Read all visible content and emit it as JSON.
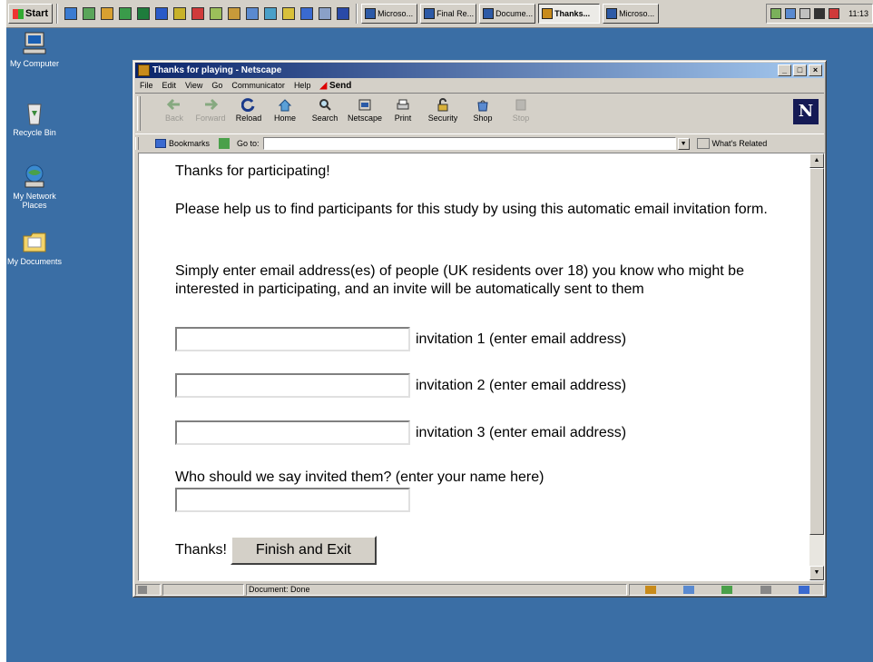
{
  "taskbar": {
    "start_label": "Start",
    "quick_launch": [
      "ie-icon",
      "desktop-icon",
      "app-icon",
      "app-icon",
      "app-icon",
      "app-icon",
      "app-icon",
      "app-icon",
      "app-icon",
      "app-icon",
      "app-icon",
      "app-icon",
      "app-icon",
      "app-icon",
      "app-icon",
      "app-icon"
    ],
    "tasks": [
      {
        "label": "Microso...",
        "active": false
      },
      {
        "label": "Final Re...",
        "active": false
      },
      {
        "label": "Docume...",
        "active": false
      },
      {
        "label": "Thanks...",
        "active": true
      },
      {
        "label": "Microso...",
        "active": false
      }
    ],
    "clock": "11:13"
  },
  "desktop": {
    "icons": [
      {
        "label": "My Computer",
        "icon": "computer-icon"
      },
      {
        "label": "Recycle Bin",
        "icon": "recycle-bin-icon"
      },
      {
        "label": "My Network Places",
        "icon": "network-icon"
      },
      {
        "label": "My Documents",
        "icon": "folder-icon"
      }
    ]
  },
  "window": {
    "title": "Thanks for playing - Netscape",
    "controls": [
      "_",
      "□",
      "×"
    ]
  },
  "menu": {
    "items": [
      "File",
      "Edit",
      "View",
      "Go",
      "Communicator",
      "Help"
    ],
    "send_label": "Send"
  },
  "toolbar": {
    "buttons": [
      {
        "label": "Back",
        "enabled": false
      },
      {
        "label": "Forward",
        "enabled": false
      },
      {
        "label": "Reload",
        "enabled": true
      },
      {
        "label": "Home",
        "enabled": true
      },
      {
        "label": "Search",
        "enabled": true
      },
      {
        "label": "Netscape",
        "enabled": true
      },
      {
        "label": "Print",
        "enabled": true
      },
      {
        "label": "Security",
        "enabled": true
      },
      {
        "label": "Shop",
        "enabled": true
      },
      {
        "label": "Stop",
        "enabled": false
      }
    ],
    "logo": "N"
  },
  "location": {
    "bookmarks_label": "Bookmarks",
    "goto_label": "Go to:",
    "url": "",
    "related_label": "What's Related"
  },
  "page": {
    "heading": "Thanks for participating!",
    "para1": "Please help us to find participants for this study by using this automatic email invitation form.",
    "para2": "Simply enter email address(es) of people (UK residents over 18) you know who might be interested in participating, and an invite will be automatically sent to them",
    "invitations": [
      {
        "value": "",
        "label": "invitation 1 (enter email address)"
      },
      {
        "value": "",
        "label": "invitation 2 (enter email address)"
      },
      {
        "value": "",
        "label": "invitation 3 (enter email address)"
      }
    ],
    "name_prompt": "Who should we say invited them? (enter your name here)",
    "name_value": "",
    "thanks_label": "Thanks!",
    "finish_label": "Finish and Exit"
  },
  "status": {
    "text": "Document: Done"
  },
  "colors": {
    "desktop": "#3a6ea5",
    "titlebar_start": "#0a246a",
    "titlebar_end": "#a6caf0",
    "chrome": "#d4d0c8"
  }
}
